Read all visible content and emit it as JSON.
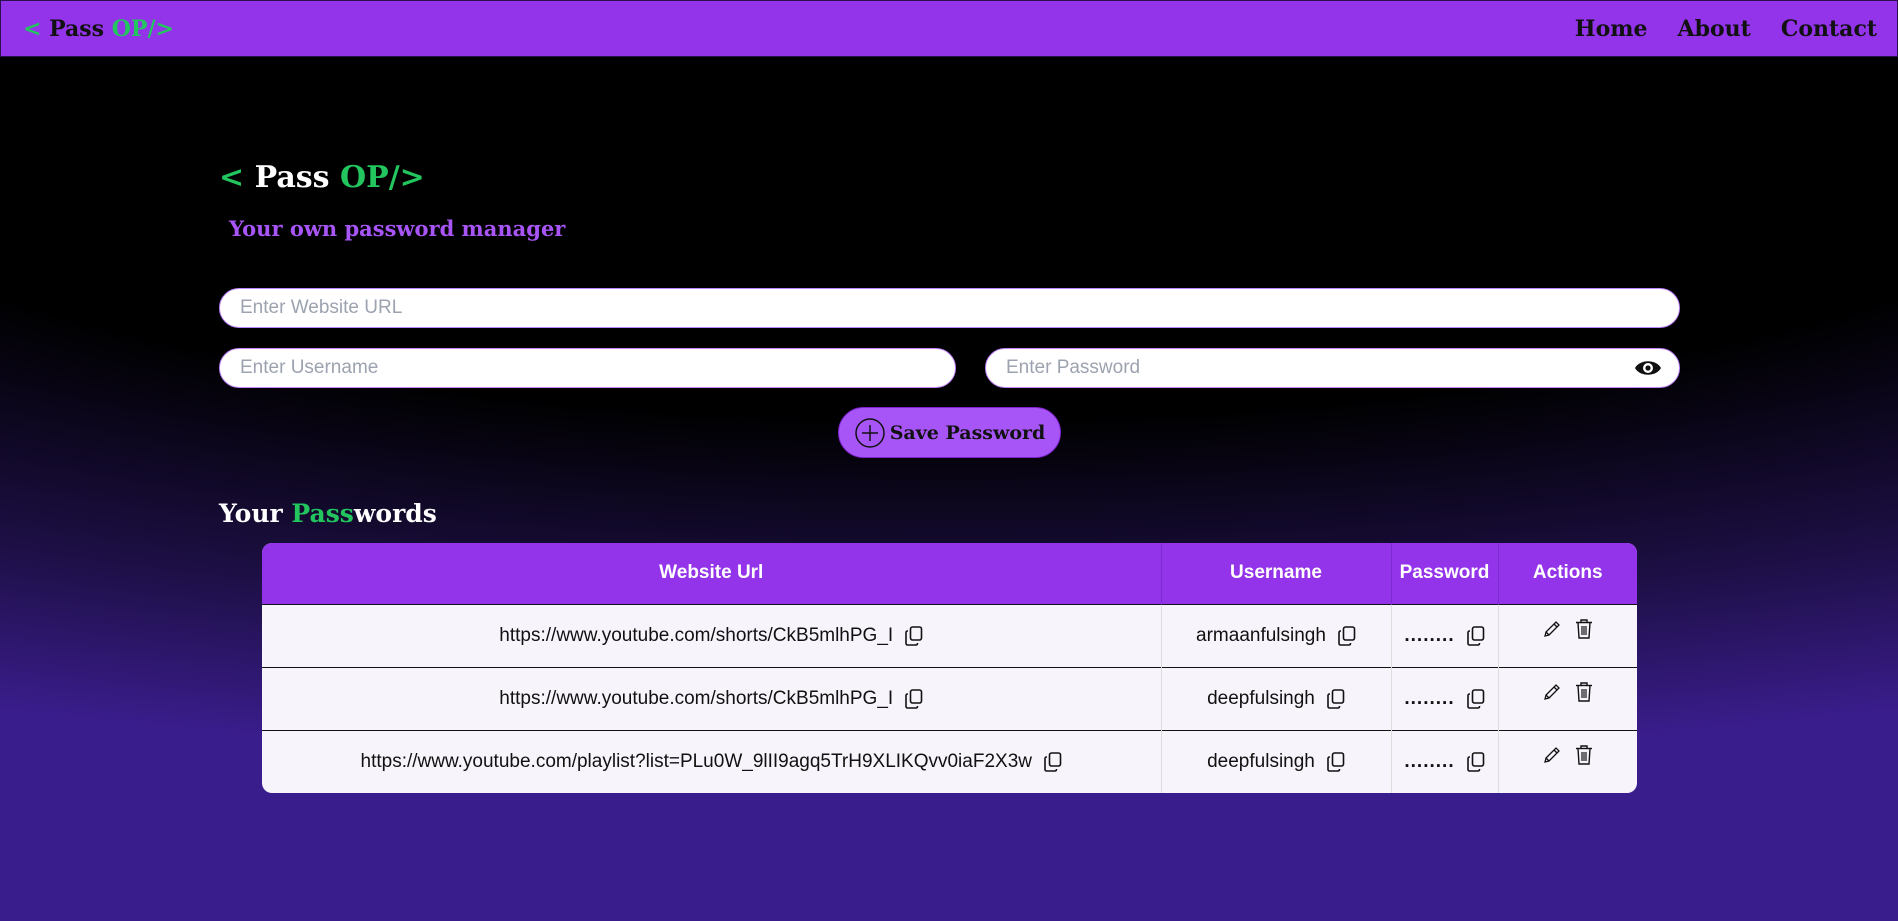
{
  "nav": {
    "logo": {
      "open": "< ",
      "name": "Pass",
      "suffix": " OP/>"
    },
    "links": [
      "Home",
      "About",
      "Contact"
    ]
  },
  "hero": {
    "logo": {
      "open": "< ",
      "name": "Pass",
      "suffix": " OP/>"
    },
    "tagline": "Your own password manager"
  },
  "form": {
    "url_placeholder": "Enter Website URL",
    "username_placeholder": "Enter Username",
    "password_placeholder": "Enter Password",
    "save_label": "Save Password"
  },
  "section": {
    "title_pre": "Your ",
    "title_green": "Pass",
    "title_post": "words"
  },
  "table": {
    "headers": [
      "Website Url",
      "Username",
      "Password",
      "Actions"
    ],
    "rows": [
      {
        "url": "https://www.youtube.com/shorts/CkB5mlhPG_I",
        "username": "armaanfulsingh",
        "password": "........"
      },
      {
        "url": "https://www.youtube.com/shorts/CkB5mlhPG_I",
        "username": "deepfulsingh",
        "password": "........"
      },
      {
        "url": "https://www.youtube.com/playlist?list=PLu0W_9lII9agq5TrH9XLIKQvv0iaF2X3w",
        "username": "deepfulsingh",
        "password": "........"
      }
    ]
  },
  "colors": {
    "accent": "#9333ea",
    "green": "#22c55e",
    "tagline": "#a855f7"
  },
  "icons": [
    "eye-icon",
    "plus-circle-icon",
    "copy-icon",
    "edit-icon",
    "delete-icon"
  ]
}
